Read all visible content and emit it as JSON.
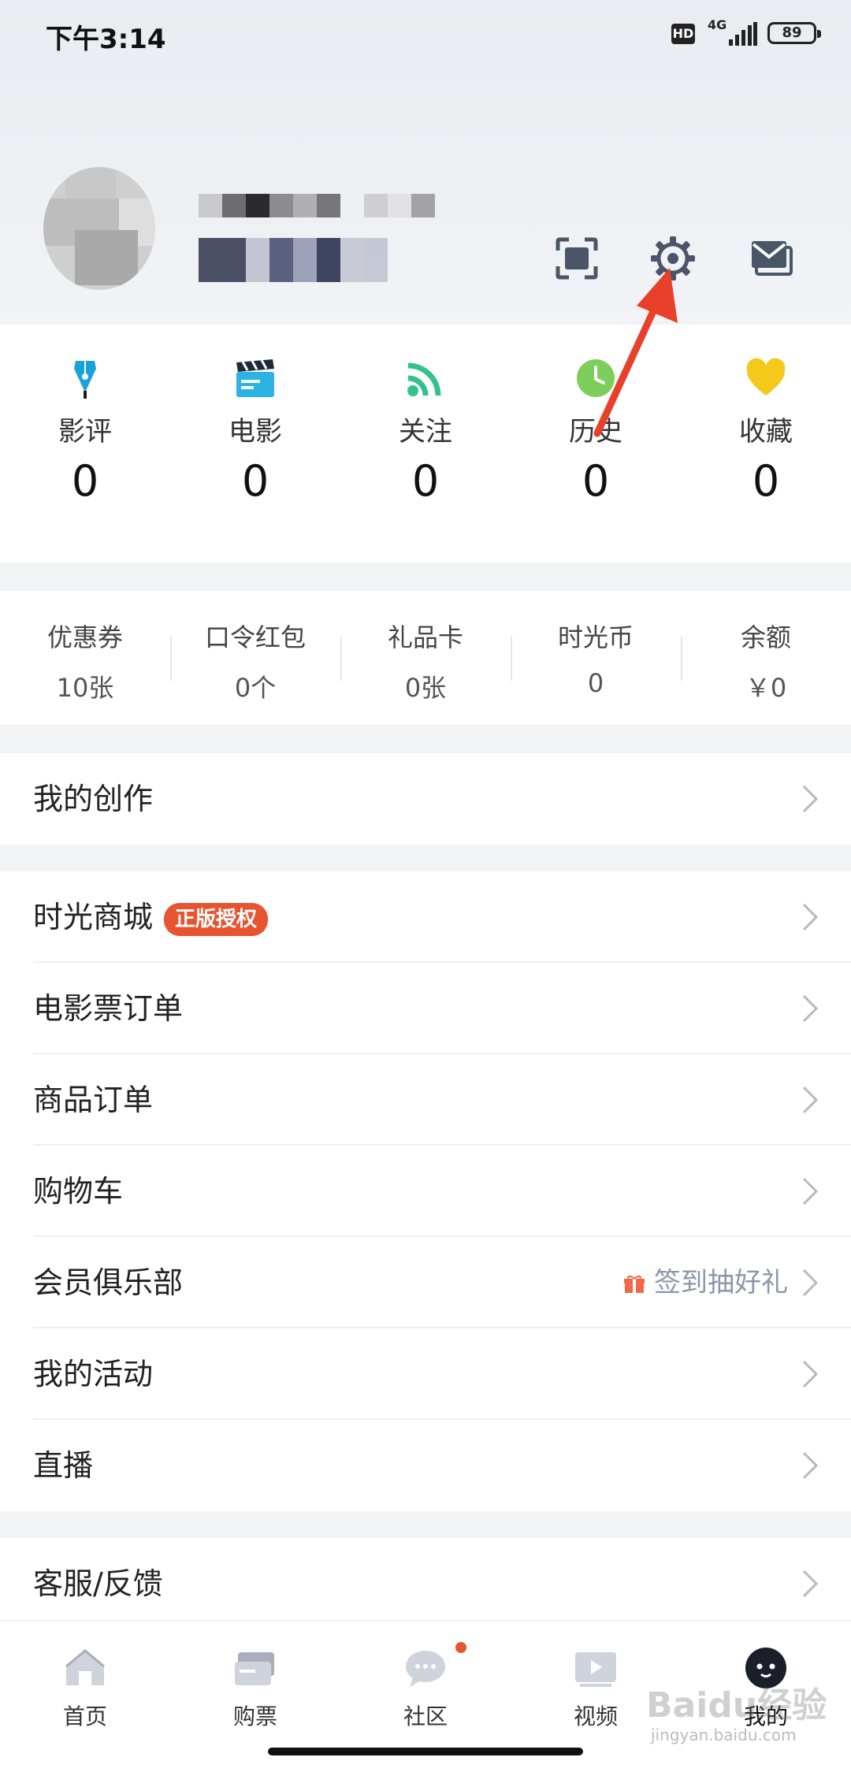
{
  "status_bar": {
    "time": "下午3:14",
    "hd": "HD",
    "network": "4G",
    "battery": "89"
  },
  "stats": [
    {
      "label": "影评",
      "value": "0",
      "icon": "pen-icon"
    },
    {
      "label": "电影",
      "value": "0",
      "icon": "clapperboard-icon"
    },
    {
      "label": "关注",
      "value": "0",
      "icon": "rss-icon"
    },
    {
      "label": "历史",
      "value": "0",
      "icon": "clock-icon"
    },
    {
      "label": "收藏",
      "value": "0",
      "icon": "heart-icon"
    }
  ],
  "wallet": [
    {
      "label": "优惠券",
      "value": "10张"
    },
    {
      "label": "口令红包",
      "value": "0个"
    },
    {
      "label": "礼品卡",
      "value": "0张"
    },
    {
      "label": "时光币",
      "value": "0"
    },
    {
      "label": "余额",
      "value": "￥0"
    }
  ],
  "rows": {
    "creation": "我的创作",
    "mall": "时光商城",
    "mall_badge": "正版授权",
    "tickets": "电影票订单",
    "goods": "商品订单",
    "cart": "购物车",
    "club": "会员俱乐部",
    "club_promo": "签到抽好礼",
    "activities": "我的活动",
    "live": "直播",
    "service": "客服/反馈"
  },
  "tabs": [
    {
      "label": "首页",
      "icon": "home-icon"
    },
    {
      "label": "购票",
      "icon": "ticket-icon"
    },
    {
      "label": "社区",
      "icon": "chat-icon"
    },
    {
      "label": "视频",
      "icon": "video-icon"
    },
    {
      "label": "我的",
      "icon": "profile-face-icon"
    }
  ],
  "watermark": {
    "brand": "Baidu经验",
    "url": "jingyan.baidu.com"
  },
  "colors": {
    "accent_red": "#e8542f",
    "icon_gray": "#4a5568"
  }
}
